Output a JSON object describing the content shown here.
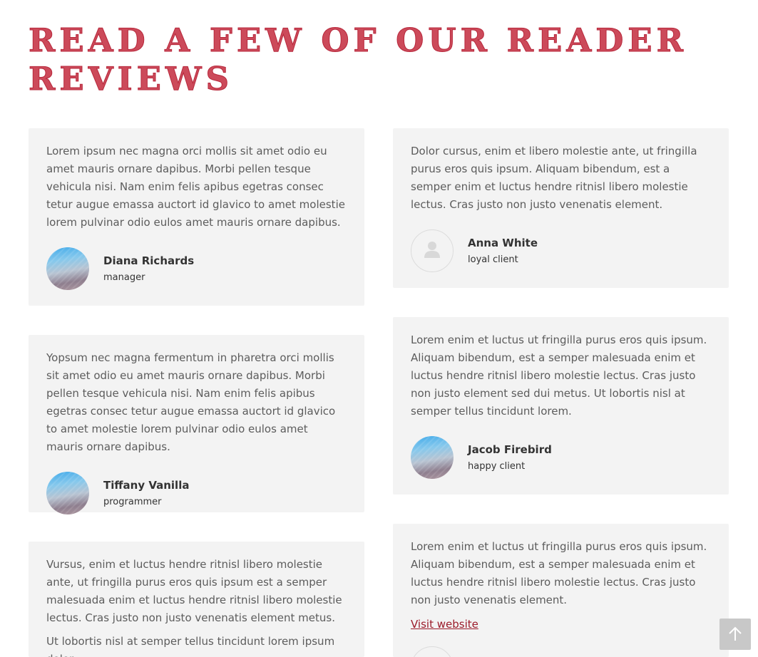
{
  "page": {
    "title": "Read a few of our reader reviews"
  },
  "reviews": [
    {
      "quote": "Lorem ipsum nec magna orci mollis sit amet odio eu amet mauris ornare dapibus. Morbi pellen tesque vehicula nisi. Nam enim felis apibus egetras consec tetur augue emassa auctort id glavico to amet molestie lorem pulvinar odio eulos amet mauris ornare dapibus.",
      "name": "Diana Richards",
      "role": "manager",
      "avatar": "photo"
    },
    {
      "quote": "Dolor cursus, enim et libero molestie ante, ut fringilla purus eros quis ipsum. Aliquam bibendum, est a semper enim et luctus hendre ritnisl libero molestie lectus. Cras justo non justo venenatis element.",
      "name": "Anna White",
      "role": "loyal client",
      "avatar": "placeholder-user-icon"
    },
    {
      "quote": "Yopsum nec magna fermentum in pharetra orci mollis sit amet odio eu amet mauris ornare dapibus. Morbi pellen tesque vehicula nisi. Nam enim felis apibus egetras consec tetur augue emassa auctort id glavico to amet molestie lorem pulvinar odio eulos amet mauris ornare dapibus.",
      "name": "Tiffany Vanilla",
      "role": "programmer",
      "avatar": "photo"
    },
    {
      "quote": "Lorem enim et luctus ut fringilla purus eros quis ipsum. Aliquam bibendum, est a semper malesuada enim et luctus hendre ritnisl libero molestie lectus. Cras justo non justo element sed dui metus. Ut lobortis nisl at semper tellus tincidunt lorem.",
      "name": "Jacob Firebird",
      "role": "happy client",
      "avatar": "photo"
    },
    {
      "quote": "Vursus, enim et luctus hendre ritnisl libero molestie ante, ut fringilla purus eros quis ipsum est a semper malesuada enim et luctus hendre ritnisl libero molestie lectus. Cras justo non justo venenatis element metus.",
      "quote_2": "Ut lobortis nisl at semper tellus tincidunt lorem ipsum dolor"
    },
    {
      "quote": "Lorem enim et luctus ut fringilla purus eros quis ipsum. Aliquam bibendum, est a semper malesuada enim et luctus hendre ritnisl libero molestie lectus. Cras justo non justo venenatis element.",
      "link_label": "Visit website"
    }
  ],
  "colors": {
    "title": "#cc4a5a",
    "card_background": "#f3f3f3",
    "link": "#9b1b2a",
    "scroll_button": "#c8c8c8"
  },
  "icons": {
    "scroll_to_top": "arrow-up-icon",
    "placeholder_avatar": "user-silhouette-icon"
  }
}
